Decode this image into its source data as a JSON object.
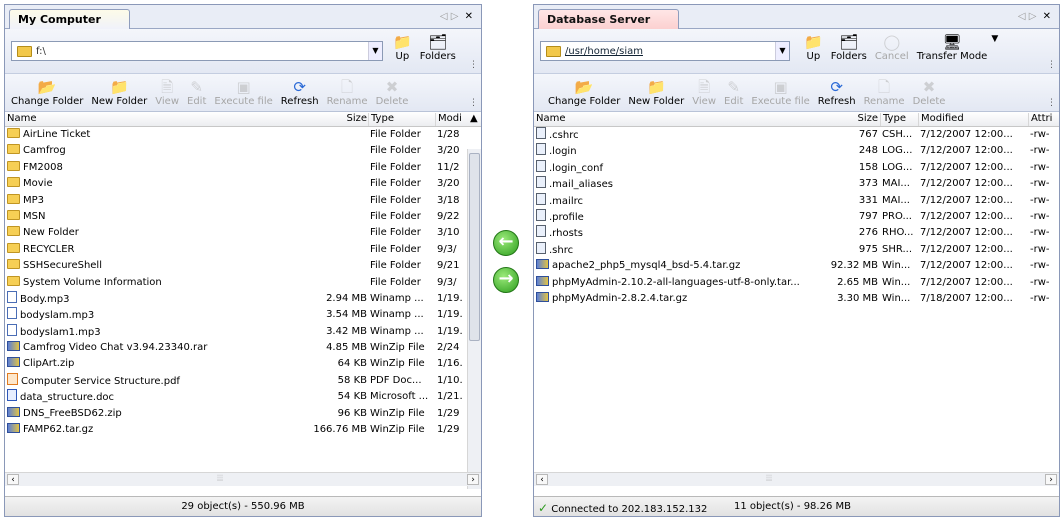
{
  "left": {
    "tab_title": "My Computer",
    "path": "f:\\",
    "nav": {
      "up": "Up",
      "folders": "Folders"
    },
    "toolbar": [
      "Change Folder",
      "New Folder",
      "View",
      "Edit",
      "Execute file",
      "Refresh",
      "Rename",
      "Delete"
    ],
    "columns": [
      "Name",
      "Size",
      "Type",
      "Modi"
    ],
    "rows": [
      {
        "name": "AirLine Ticket",
        "size": "",
        "type": "File Folder",
        "mod": "1/28",
        "icon": "folder"
      },
      {
        "name": "Camfrog",
        "size": "",
        "type": "File Folder",
        "mod": "3/20",
        "icon": "folder"
      },
      {
        "name": "FM2008",
        "size": "",
        "type": "File Folder",
        "mod": "11/2",
        "icon": "folder"
      },
      {
        "name": "Movie",
        "size": "",
        "type": "File Folder",
        "mod": "3/20",
        "icon": "folder"
      },
      {
        "name": "MP3",
        "size": "",
        "type": "File Folder",
        "mod": "3/18",
        "icon": "folder"
      },
      {
        "name": "MSN",
        "size": "",
        "type": "File Folder",
        "mod": "9/22",
        "icon": "folder"
      },
      {
        "name": "New Folder",
        "size": "",
        "type": "File Folder",
        "mod": "3/10",
        "icon": "folder"
      },
      {
        "name": "RECYCLER",
        "size": "",
        "type": "File Folder",
        "mod": "9/3/",
        "icon": "folder"
      },
      {
        "name": "SSHSecureShell",
        "size": "",
        "type": "File Folder",
        "mod": "9/21",
        "icon": "folder"
      },
      {
        "name": "System Volume Information",
        "size": "",
        "type": "File Folder",
        "mod": "9/3/",
        "icon": "folder"
      },
      {
        "name": "Body.mp3",
        "size": "2.94 MB",
        "type": "Winamp ...",
        "mod": "1/19.",
        "icon": "mp3"
      },
      {
        "name": "bodyslam.mp3",
        "size": "3.54 MB",
        "type": "Winamp ...",
        "mod": "1/19.",
        "icon": "mp3"
      },
      {
        "name": "bodyslam1.mp3",
        "size": "3.42 MB",
        "type": "Winamp ...",
        "mod": "1/19.",
        "icon": "mp3"
      },
      {
        "name": "Camfrog Video Chat v3.94.23340.rar",
        "size": "4.85 MB",
        "type": "WinZip File",
        "mod": "2/24",
        "icon": "zip"
      },
      {
        "name": "ClipArt.zip",
        "size": "64 KB",
        "type": "WinZip File",
        "mod": "1/16.",
        "icon": "zip"
      },
      {
        "name": "Computer Service Structure.pdf",
        "size": "58 KB",
        "type": "PDF Doc...",
        "mod": "1/10.",
        "icon": "pdf"
      },
      {
        "name": "data_structure.doc",
        "size": "54 KB",
        "type": "Microsoft ...",
        "mod": "1/21.",
        "icon": "doc"
      },
      {
        "name": "DNS_FreeBSD62.zip",
        "size": "96 KB",
        "type": "WinZip File",
        "mod": "1/29",
        "icon": "zip"
      },
      {
        "name": "FAMP62.tar.gz",
        "size": "166.76 MB",
        "type": "WinZip File",
        "mod": "1/29",
        "icon": "zip"
      }
    ],
    "status": "29 object(s) - 550.96 MB"
  },
  "right": {
    "tab_title": "Database Server",
    "path": "/usr/home/siam",
    "nav": {
      "up": "Up",
      "folders": "Folders",
      "cancel": "Cancel",
      "transfer_mode": "Transfer Mode"
    },
    "toolbar": [
      "Change Folder",
      "New Folder",
      "View",
      "Edit",
      "Execute file",
      "Refresh",
      "Rename",
      "Delete"
    ],
    "columns": [
      "Name",
      "Size",
      "Type",
      "Modified",
      "Attri"
    ],
    "rows": [
      {
        "name": ".cshrc",
        "size": "767",
        "type": "CSH...",
        "mod": "7/12/2007 12:00...",
        "attr": "-rw-",
        "icon": "txt"
      },
      {
        "name": ".login",
        "size": "248",
        "type": "LOG...",
        "mod": "7/12/2007 12:00...",
        "attr": "-rw-",
        "icon": "txt"
      },
      {
        "name": ".login_conf",
        "size": "158",
        "type": "LOG...",
        "mod": "7/12/2007 12:00...",
        "attr": "-rw-",
        "icon": "txt"
      },
      {
        "name": ".mail_aliases",
        "size": "373",
        "type": "MAI...",
        "mod": "7/12/2007 12:00...",
        "attr": "-rw-",
        "icon": "txt"
      },
      {
        "name": ".mailrc",
        "size": "331",
        "type": "MAI...",
        "mod": "7/12/2007 12:00...",
        "attr": "-rw-",
        "icon": "txt"
      },
      {
        "name": ".profile",
        "size": "797",
        "type": "PRO...",
        "mod": "7/12/2007 12:00...",
        "attr": "-rw-",
        "icon": "txt"
      },
      {
        "name": ".rhosts",
        "size": "276",
        "type": "RHO...",
        "mod": "7/12/2007 12:00...",
        "attr": "-rw-",
        "icon": "txt"
      },
      {
        "name": ".shrc",
        "size": "975",
        "type": "SHR...",
        "mod": "7/12/2007 12:00...",
        "attr": "-rw-",
        "icon": "txt"
      },
      {
        "name": "apache2_php5_mysql4_bsd-5.4.tar.gz",
        "size": "92.32 MB",
        "type": "Win...",
        "mod": "7/12/2007 12:00...",
        "attr": "-rw-",
        "icon": "zip"
      },
      {
        "name": "phpMyAdmin-2.10.2-all-languages-utf-8-only.tar...",
        "size": "2.65 MB",
        "type": "Win...",
        "mod": "7/12/2007 12:00...",
        "attr": "-rw-",
        "icon": "zip"
      },
      {
        "name": "phpMyAdmin-2.8.2.4.tar.gz",
        "size": "3.30 MB",
        "type": "Win...",
        "mod": "7/18/2007 12:00...",
        "attr": "-rw-",
        "icon": "zip"
      }
    ],
    "status_connection": "Connected to 202.183.152.132",
    "status_objects": "11 object(s) - 98.26 MB"
  },
  "colors": {
    "left_tab": "#f0f2fa",
    "right_tab": "#fbd0d0",
    "accent_green": "#2c9d1d",
    "folder": "#f6cf55"
  }
}
